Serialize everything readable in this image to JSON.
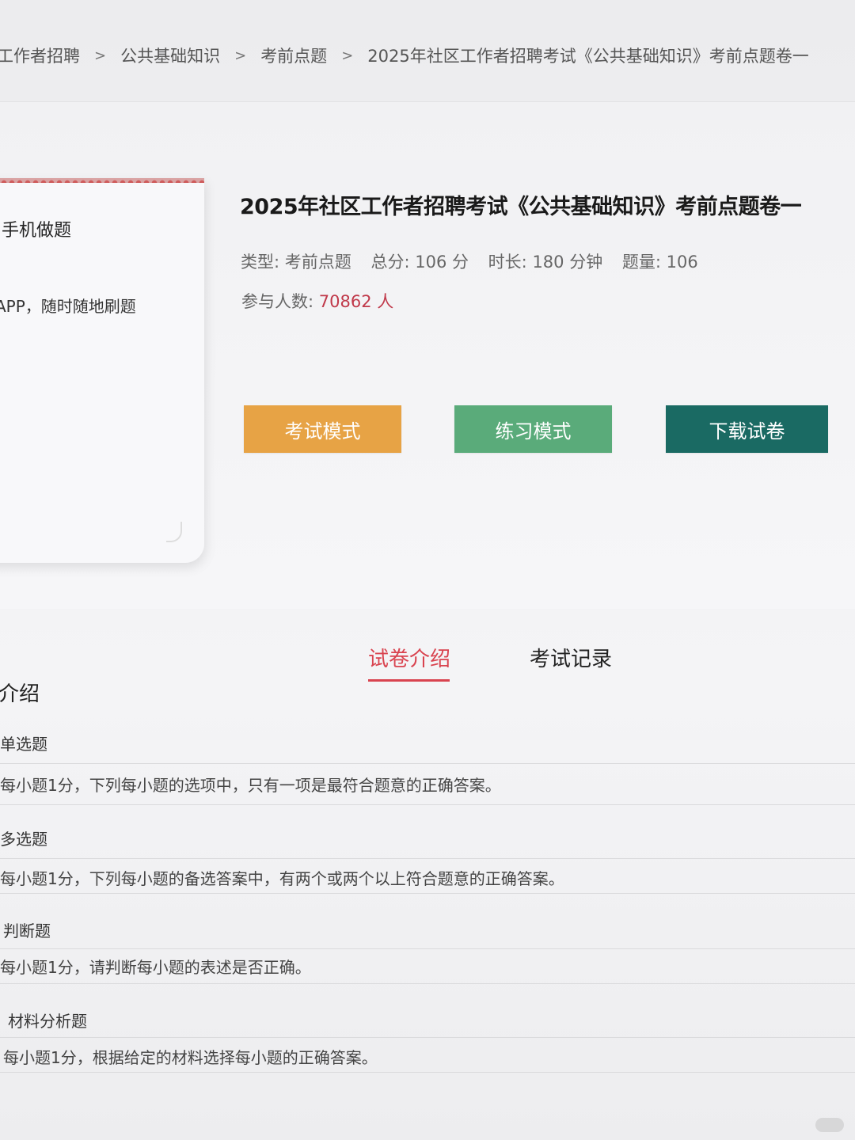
{
  "breadcrumb": {
    "items": [
      "工作者招聘",
      "公共基础知识",
      "考前点题",
      "2025年社区工作者招聘考试《公共基础知识》考前点题卷一"
    ],
    "separator": ">"
  },
  "side_panel": {
    "title": "手机做题",
    "desc": "APP，随时随地刷题"
  },
  "exam": {
    "title": "2025年社区工作者招聘考试《公共基础知识》考前点题卷一",
    "type_label": "类型:",
    "type_value": "考前点题",
    "score_label": "总分:",
    "score_value": "106 分",
    "duration_label": "时长:",
    "duration_value": "180 分钟",
    "count_label": "题量:",
    "count_value": "106",
    "participants_label": "参与人数:",
    "participants_value": "70862 人"
  },
  "buttons": {
    "exam_mode": "考试模式",
    "practice_mode": "练习模式",
    "download": "下载试卷"
  },
  "tabs": {
    "intro": "试卷介绍",
    "records": "考试记录",
    "active": "intro"
  },
  "intro": {
    "section_title": "介绍",
    "types": [
      {
        "name": "单选题",
        "desc": "每小题1分，下列每小题的选项中，只有一项是最符合题意的正确答案。"
      },
      {
        "name": "多选题",
        "desc": "每小题1分，下列每小题的备选答案中，有两个或两个以上符合题意的正确答案。"
      },
      {
        "name": "判断题",
        "desc": "每小题1分，请判断每小题的表述是否正确。"
      },
      {
        "name": "材料分析题",
        "desc": "每小题1分，根据给定的材料选择每小题的正确答案。"
      }
    ]
  },
  "colors": {
    "exam_button": "#e7a345",
    "practice_button": "#5aab7a",
    "download_button": "#1a6a63",
    "accent_red": "#d9434f"
  }
}
